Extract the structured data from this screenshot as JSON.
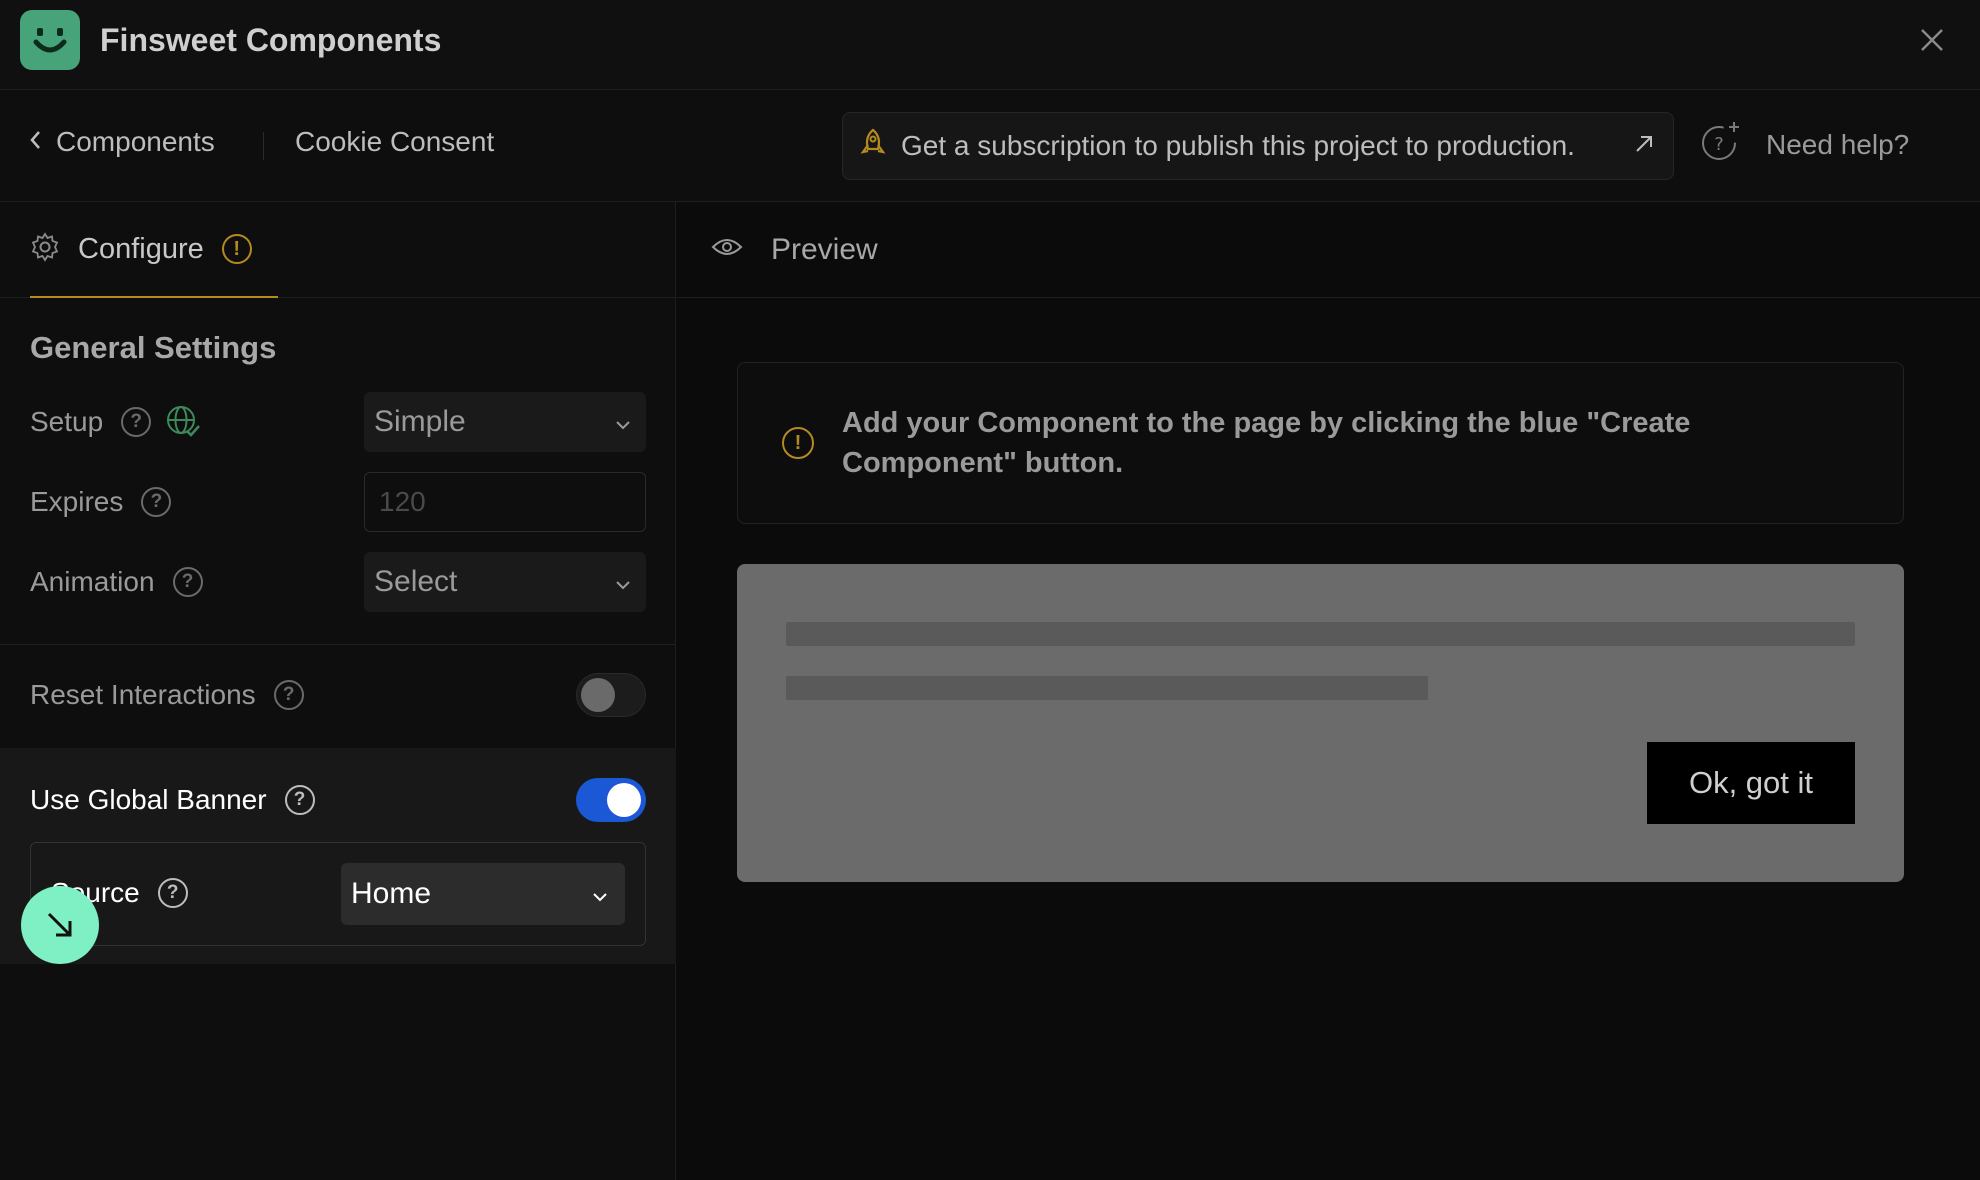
{
  "app": {
    "title": "Finsweet Components"
  },
  "nav": {
    "back_label": "Components",
    "current": "Cookie Consent",
    "subscription_text": "Get a subscription to publish this project to production.",
    "help_label": "Need help?"
  },
  "configure": {
    "tab_label": "Configure",
    "warning_badge": "!",
    "section_title": "General Settings",
    "setup": {
      "label": "Setup",
      "value": "Simple"
    },
    "expires": {
      "label": "Expires",
      "placeholder": "120"
    },
    "animation": {
      "label": "Animation",
      "value": "Select"
    },
    "reset_interactions": {
      "label": "Reset Interactions",
      "enabled": false
    },
    "use_global_banner": {
      "label": "Use Global Banner",
      "enabled": true
    },
    "source": {
      "label": "Source",
      "value": "Home"
    }
  },
  "preview": {
    "tab_label": "Preview",
    "info_text": "Add your Component to the page by clicking the blue \"Create Component\" button.",
    "ok_button": "Ok, got it"
  },
  "icons": {
    "logo": "smile-logo-icon",
    "close": "close-icon",
    "back": "chevron-left-icon",
    "rocket": "rocket-icon",
    "external": "arrow-up-right-icon",
    "help": "help-sparkle-icon",
    "gear": "gear-icon",
    "globe": "globe-check-icon",
    "eye": "eye-icon",
    "cursor": "arrow-down-right-icon"
  },
  "colors": {
    "accent_toggle": "#1b58d6",
    "warning": "#b58a1e",
    "logo": "#46a37a",
    "cursor": "#7ff0c3"
  }
}
